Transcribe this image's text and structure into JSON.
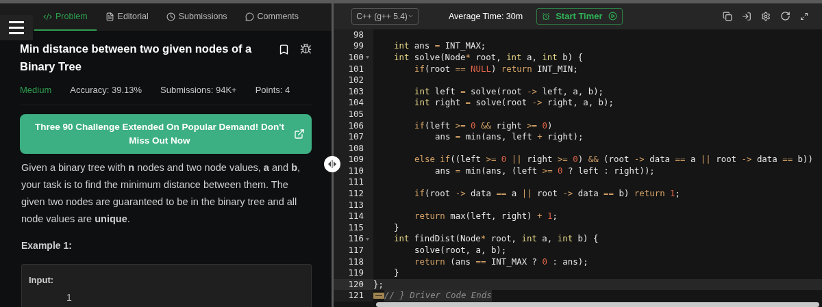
{
  "tabs": [
    {
      "label": "Problem",
      "selected": true
    },
    {
      "label": "Editorial",
      "selected": false
    },
    {
      "label": "Submissions",
      "selected": false
    },
    {
      "label": "Comments",
      "selected": false
    }
  ],
  "problem": {
    "title": "Min distance between two given nodes of a Binary Tree",
    "difficulty": "Medium",
    "accuracy": "Accuracy: 39.13%",
    "submissions": "Submissions: 94K+",
    "points": "Points: 4",
    "banner": "Three 90 Challenge Extended On Popular Demand! Don't Miss Out Now",
    "description": "Given a binary tree with **n** nodes and two node values, **a** and **b**, your task is to find the minimum distance between them. The given two nodes are guaranteed to be in the binary tree and all node values are **unique**.",
    "example_title": "Example 1:",
    "input_label": "Input:",
    "input_value": "1"
  },
  "editor": {
    "language": "C++ (g++ 5.4)",
    "average_time": "Average Time: 30m",
    "timer_button": "Start Timer",
    "lines": [
      {
        "number": "98",
        "fold": false,
        "active": false,
        "kind": "blank"
      },
      {
        "number": "99",
        "fold": false,
        "active": false,
        "kind": "member",
        "tokens": [
          {
            "text": "int",
            "kind": "type"
          },
          {
            "text": " ans ",
            "kind": "plain"
          },
          {
            "text": "=",
            "kind": "op"
          },
          {
            "text": " INT_MAX;",
            "kind": "plain"
          }
        ]
      },
      {
        "number": "100",
        "fold": true,
        "active": false,
        "kind": "member",
        "tokens": [
          {
            "text": "int",
            "kind": "type"
          },
          {
            "text": " solve(Node",
            "kind": "plain"
          },
          {
            "text": "*",
            "kind": "op"
          },
          {
            "text": " root, ",
            "kind": "plain"
          },
          {
            "text": "int",
            "kind": "type"
          },
          {
            "text": " a, ",
            "kind": "plain"
          },
          {
            "text": "int",
            "kind": "type"
          },
          {
            "text": " b) {",
            "kind": "plain"
          }
        ]
      },
      {
        "number": "101",
        "fold": false,
        "active": false,
        "kind": "body",
        "tokens": [
          {
            "text": "if",
            "kind": "keyword"
          },
          {
            "text": "(root ",
            "kind": "plain"
          },
          {
            "text": "== ",
            "kind": "op"
          },
          {
            "text": "NULL",
            "kind": "number"
          },
          {
            "text": ") ",
            "kind": "plain"
          },
          {
            "text": "return",
            "kind": "keyword"
          },
          {
            "text": " INT_MIN;",
            "kind": "plain"
          }
        ]
      },
      {
        "number": "102",
        "fold": false,
        "active": false,
        "kind": "blank"
      },
      {
        "number": "103",
        "fold": false,
        "active": false,
        "kind": "body",
        "tokens": [
          {
            "text": "int",
            "kind": "type"
          },
          {
            "text": " left ",
            "kind": "plain"
          },
          {
            "text": "=",
            "kind": "op"
          },
          {
            "text": " solve(root ",
            "kind": "plain"
          },
          {
            "text": "->",
            "kind": "op"
          },
          {
            "text": " left, a, b);",
            "kind": "plain"
          }
        ]
      },
      {
        "number": "104",
        "fold": false,
        "active": false,
        "kind": "body",
        "tokens": [
          {
            "text": "int",
            "kind": "type"
          },
          {
            "text": " right ",
            "kind": "plain"
          },
          {
            "text": "=",
            "kind": "op"
          },
          {
            "text": " solve(root ",
            "kind": "plain"
          },
          {
            "text": "->",
            "kind": "op"
          },
          {
            "text": " right, a, b);",
            "kind": "plain"
          }
        ]
      },
      {
        "number": "105",
        "fold": false,
        "active": false,
        "kind": "blank"
      },
      {
        "number": "106",
        "fold": false,
        "active": false,
        "kind": "body",
        "tokens": [
          {
            "text": "if",
            "kind": "keyword"
          },
          {
            "text": "(left ",
            "kind": "plain"
          },
          {
            "text": ">= ",
            "kind": "op"
          },
          {
            "text": "0",
            "kind": "number"
          },
          {
            "text": " && ",
            "kind": "op"
          },
          {
            "text": "right ",
            "kind": "plain"
          },
          {
            "text": ">= ",
            "kind": "op"
          },
          {
            "text": "0",
            "kind": "number"
          },
          {
            "text": ")",
            "kind": "plain"
          }
        ]
      },
      {
        "number": "107",
        "fold": false,
        "active": false,
        "kind": "inner",
        "tokens": [
          {
            "text": "ans ",
            "kind": "plain"
          },
          {
            "text": "=",
            "kind": "op"
          },
          {
            "text": " min(ans, left ",
            "kind": "plain"
          },
          {
            "text": "+",
            "kind": "op"
          },
          {
            "text": " right);",
            "kind": "plain"
          }
        ]
      },
      {
        "number": "108",
        "fold": false,
        "active": false,
        "kind": "blank"
      },
      {
        "number": "109",
        "fold": false,
        "active": false,
        "kind": "body",
        "tokens": [
          {
            "text": "else if",
            "kind": "keyword"
          },
          {
            "text": "((left ",
            "kind": "plain"
          },
          {
            "text": ">= ",
            "kind": "op"
          },
          {
            "text": "0",
            "kind": "number"
          },
          {
            "text": " || ",
            "kind": "op"
          },
          {
            "text": "right ",
            "kind": "plain"
          },
          {
            "text": ">= ",
            "kind": "op"
          },
          {
            "text": "0",
            "kind": "number"
          },
          {
            "text": ") ",
            "kind": "plain"
          },
          {
            "text": "&&",
            "kind": "op"
          },
          {
            "text": " (root ",
            "kind": "plain"
          },
          {
            "text": "->",
            "kind": "op"
          },
          {
            "text": " data ",
            "kind": "plain"
          },
          {
            "text": "==",
            "kind": "op"
          },
          {
            "text": " a ",
            "kind": "plain"
          },
          {
            "text": "||",
            "kind": "op"
          },
          {
            "text": " root ",
            "kind": "plain"
          },
          {
            "text": "->",
            "kind": "op"
          },
          {
            "text": " data ",
            "kind": "plain"
          },
          {
            "text": "==",
            "kind": "op"
          },
          {
            "text": " b))",
            "kind": "plain"
          }
        ]
      },
      {
        "number": "110",
        "fold": false,
        "active": false,
        "kind": "inner",
        "tokens": [
          {
            "text": "ans ",
            "kind": "plain"
          },
          {
            "text": "=",
            "kind": "op"
          },
          {
            "text": " min(ans, (left ",
            "kind": "plain"
          },
          {
            "text": ">= ",
            "kind": "op"
          },
          {
            "text": "0",
            "kind": "number"
          },
          {
            "text": " ? left : right));",
            "kind": "plain"
          }
        ]
      },
      {
        "number": "111",
        "fold": false,
        "active": false,
        "kind": "blank"
      },
      {
        "number": "112",
        "fold": false,
        "active": false,
        "kind": "body",
        "tokens": [
          {
            "text": "if",
            "kind": "keyword"
          },
          {
            "text": "(root ",
            "kind": "plain"
          },
          {
            "text": "->",
            "kind": "op"
          },
          {
            "text": " data ",
            "kind": "plain"
          },
          {
            "text": "==",
            "kind": "op"
          },
          {
            "text": " a ",
            "kind": "plain"
          },
          {
            "text": "||",
            "kind": "op"
          },
          {
            "text": " root ",
            "kind": "plain"
          },
          {
            "text": "->",
            "kind": "op"
          },
          {
            "text": " data ",
            "kind": "plain"
          },
          {
            "text": "==",
            "kind": "op"
          },
          {
            "text": " b) ",
            "kind": "plain"
          },
          {
            "text": "return",
            "kind": "keyword"
          },
          {
            "text": " 1",
            "kind": "number"
          },
          {
            "text": ";",
            "kind": "plain"
          }
        ]
      },
      {
        "number": "113",
        "fold": false,
        "active": false,
        "kind": "blank"
      },
      {
        "number": "114",
        "fold": false,
        "active": false,
        "kind": "body",
        "tokens": [
          {
            "text": "return",
            "kind": "keyword"
          },
          {
            "text": " max(left, right) ",
            "kind": "plain"
          },
          {
            "text": "+ ",
            "kind": "op"
          },
          {
            "text": "1",
            "kind": "number"
          },
          {
            "text": ";",
            "kind": "plain"
          }
        ]
      },
      {
        "number": "115",
        "fold": false,
        "active": false,
        "kind": "member",
        "tokens": [
          {
            "text": "}",
            "kind": "plain"
          }
        ]
      },
      {
        "number": "116",
        "fold": true,
        "active": false,
        "kind": "member",
        "tokens": [
          {
            "text": "int",
            "kind": "type"
          },
          {
            "text": " findDist(Node",
            "kind": "plain"
          },
          {
            "text": "*",
            "kind": "op"
          },
          {
            "text": " root, ",
            "kind": "plain"
          },
          {
            "text": "int",
            "kind": "type"
          },
          {
            "text": " a, ",
            "kind": "plain"
          },
          {
            "text": "int",
            "kind": "type"
          },
          {
            "text": " b) {",
            "kind": "plain"
          }
        ]
      },
      {
        "number": "117",
        "fold": false,
        "active": false,
        "kind": "body",
        "tokens": [
          {
            "text": "solve(root, a, b);",
            "kind": "plain"
          }
        ]
      },
      {
        "number": "118",
        "fold": false,
        "active": false,
        "kind": "body",
        "tokens": [
          {
            "text": "return",
            "kind": "keyword"
          },
          {
            "text": " (ans ",
            "kind": "plain"
          },
          {
            "text": "==",
            "kind": "op"
          },
          {
            "text": " INT_MAX ? ",
            "kind": "plain"
          },
          {
            "text": "0",
            "kind": "number"
          },
          {
            "text": " : ans);",
            "kind": "plain"
          }
        ]
      },
      {
        "number": "119",
        "fold": false,
        "active": false,
        "kind": "member",
        "tokens": [
          {
            "text": "}",
            "kind": "plain"
          }
        ]
      },
      {
        "number": "120",
        "fold": false,
        "active": true,
        "kind": "top",
        "tokens": [
          {
            "text": "};",
            "kind": "plain"
          }
        ]
      },
      {
        "number": "121",
        "fold": false,
        "active": false,
        "kind": "folded",
        "tokens": [
          {
            "text": "// } Driver Code Ends",
            "kind": "comment"
          }
        ]
      }
    ]
  }
}
